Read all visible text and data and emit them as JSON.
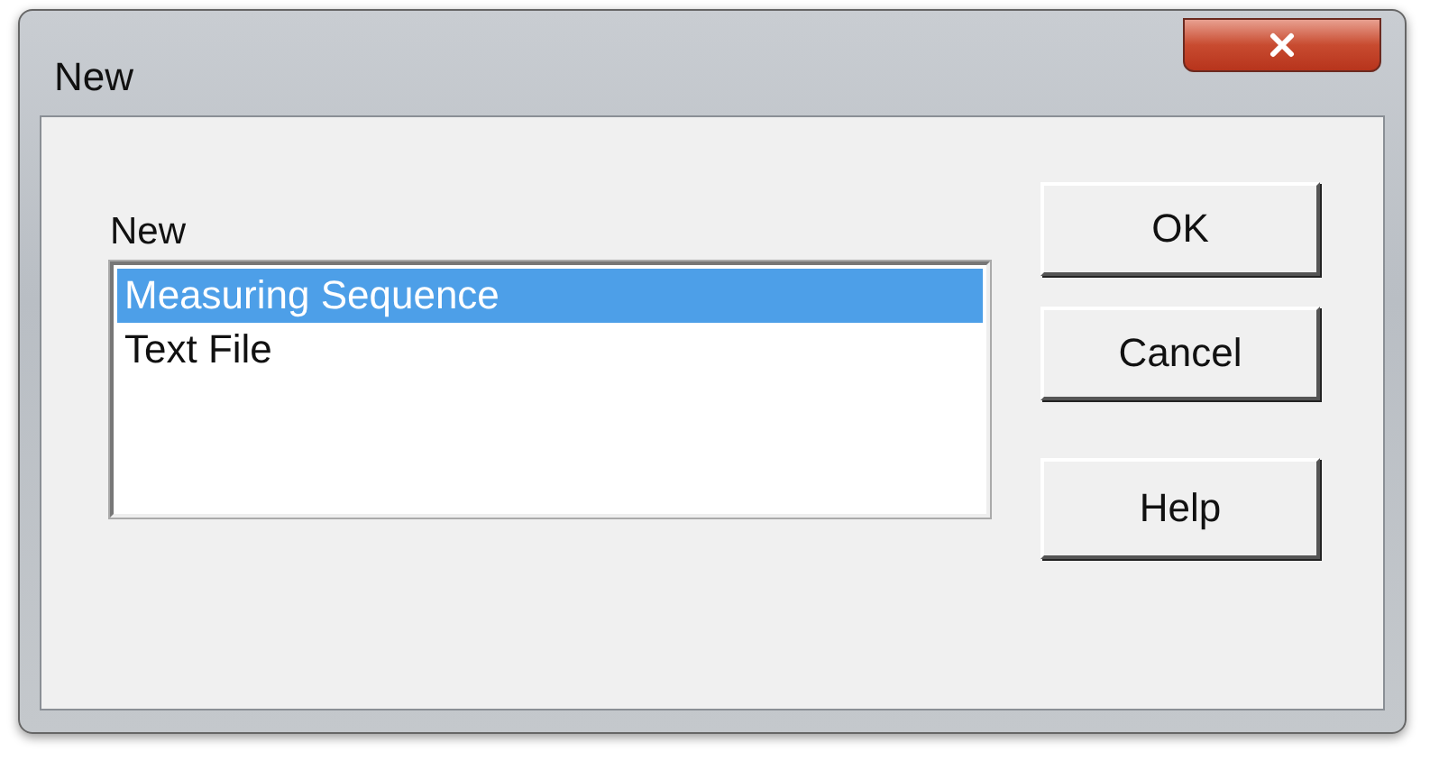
{
  "window": {
    "title": "New"
  },
  "list": {
    "label": "New",
    "items": [
      {
        "label": "Measuring Sequence",
        "selected": true
      },
      {
        "label": "Text File",
        "selected": false
      }
    ]
  },
  "buttons": [
    "OK",
    "Cancel",
    "Help"
  ]
}
